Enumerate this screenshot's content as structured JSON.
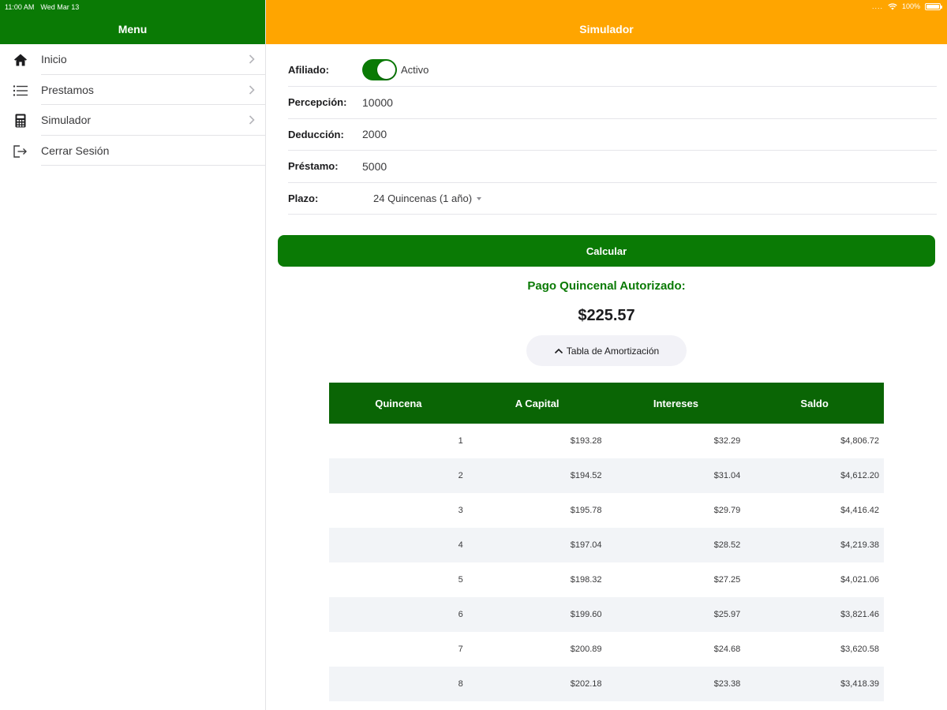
{
  "status_bar": {
    "time": "11:00 AM",
    "date": "Wed Mar 13",
    "signal": "....",
    "battery_text": "100%",
    "battery_level": 1.0
  },
  "sidebar": {
    "title": "Menu",
    "items": [
      {
        "label": "Inicio",
        "icon": "home-icon",
        "chevron": true
      },
      {
        "label": "Prestamos",
        "icon": "list-icon",
        "chevron": true
      },
      {
        "label": "Simulador",
        "icon": "calculator-icon",
        "chevron": true
      },
      {
        "label": "Cerrar Sesión",
        "icon": "logout-icon",
        "chevron": false
      }
    ]
  },
  "main": {
    "title": "Simulador",
    "form": {
      "afiliado_label": "Afiliado:",
      "afiliado_toggle_on": true,
      "afiliado_state": "Activo",
      "percepcion_label": "Percepción:",
      "percepcion_value": "10000",
      "deduccion_label": "Deducción:",
      "deduccion_value": "2000",
      "prestamo_label": "Préstamo:",
      "prestamo_value": "5000",
      "plazo_label": "Plazo:",
      "plazo_value": "24 Quincenas (1 año)"
    },
    "calc_button": "Calcular",
    "result_label": "Pago Quincenal Autorizado:",
    "result_value": "$225.57",
    "amort_toggle": "Tabla de Amortización",
    "table": {
      "headers": [
        "Quincena",
        "A Capital",
        "Intereses",
        "Saldo"
      ],
      "rows": [
        [
          "1",
          "$193.28",
          "$32.29",
          "$4,806.72"
        ],
        [
          "2",
          "$194.52",
          "$31.04",
          "$4,612.20"
        ],
        [
          "3",
          "$195.78",
          "$29.79",
          "$4,416.42"
        ],
        [
          "4",
          "$197.04",
          "$28.52",
          "$4,219.38"
        ],
        [
          "5",
          "$198.32",
          "$27.25",
          "$4,021.06"
        ],
        [
          "6",
          "$199.60",
          "$25.97",
          "$3,821.46"
        ],
        [
          "7",
          "$200.89",
          "$24.68",
          "$3,620.58"
        ],
        [
          "8",
          "$202.18",
          "$23.38",
          "$3,418.39"
        ]
      ]
    }
  },
  "colors": {
    "green": "#0a7a05",
    "table_header_green": "#0a6505",
    "orange": "#ffa500",
    "row_alt": "#f2f4f7"
  }
}
